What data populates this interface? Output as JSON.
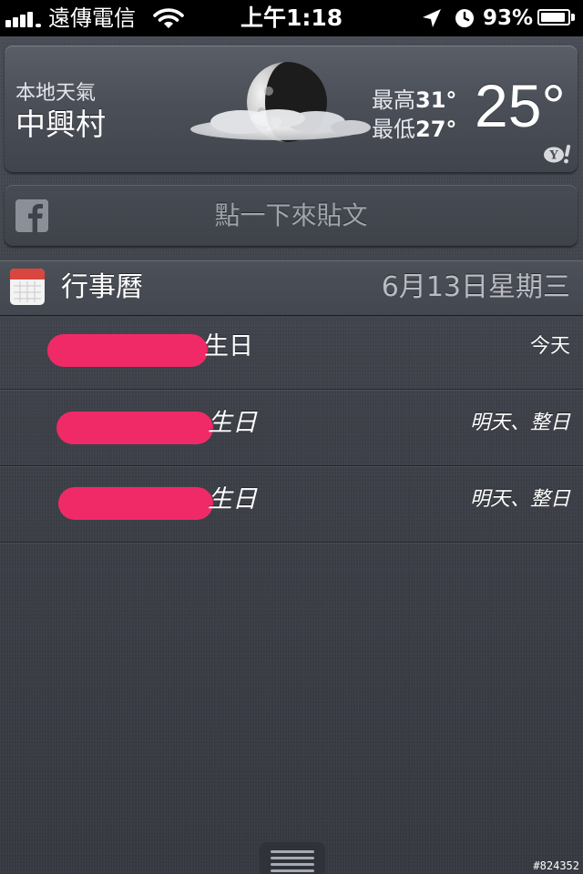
{
  "status_bar": {
    "carrier": "遠傳電信",
    "time": "上午1:18",
    "battery_percent": "93%",
    "battery_level": 0.93,
    "signal_bars": 5,
    "icons": [
      "signal-icon",
      "wifi-icon",
      "location-arrow-icon",
      "alarm-clock-icon",
      "battery-icon"
    ]
  },
  "weather": {
    "label": "本地天氣",
    "location": "中興村",
    "high_label": "最高",
    "high_value": "31°",
    "low_label": "最低",
    "low_value": "27°",
    "current_temp": "25°",
    "condition_icon": "moon-cloud-icon",
    "provider_icon": "yahoo-icon"
  },
  "facebook": {
    "prompt": "點一下來貼文",
    "icon": "facebook-icon"
  },
  "calendar": {
    "title": "行事曆",
    "date": "6月13日星期三",
    "icon": "calendar-icon",
    "events": [
      {
        "title": "生日",
        "time": "今天"
      },
      {
        "title": "生日",
        "time": "明天、整日"
      },
      {
        "title": "生日",
        "time": "明天、整日"
      }
    ]
  },
  "watermark": "#824352",
  "colors": {
    "redaction": "#f02a66",
    "status_bar": "#000000",
    "background": "#3f434b"
  }
}
